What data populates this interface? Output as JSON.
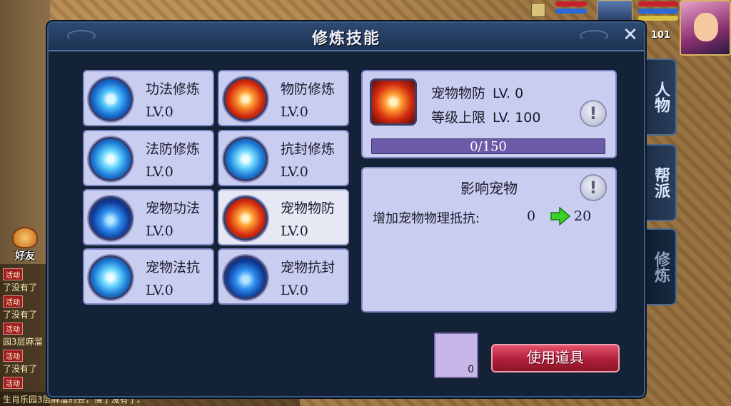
{
  "dialog": {
    "title": "修炼技能"
  },
  "skills": [
    {
      "name": "功法修炼",
      "level": "LV.0",
      "icon": "kungfu-cultivation-icon"
    },
    {
      "name": "物防修炼",
      "level": "LV.0",
      "icon": "physical-defense-icon"
    },
    {
      "name": "法防修炼",
      "level": "LV.0",
      "icon": "magic-defense-icon"
    },
    {
      "name": "抗封修炼",
      "level": "LV.0",
      "icon": "seal-resist-icon"
    },
    {
      "name": "宠物功法",
      "level": "LV.0",
      "icon": "pet-kungfu-icon"
    },
    {
      "name": "宠物物防",
      "level": "LV.0",
      "icon": "pet-physical-defense-icon",
      "selected": true
    },
    {
      "name": "宠物法抗",
      "level": "LV.0",
      "icon": "pet-magic-resist-icon"
    },
    {
      "name": "宠物抗封",
      "level": "LV.0",
      "icon": "pet-seal-resist-icon"
    }
  ],
  "detail": {
    "name": "宠物物防",
    "level": "LV. 0",
    "cap_label": "等级上限",
    "cap_value": "LV. 100",
    "progress_text": "0/150",
    "progress_current": 0,
    "progress_max": 150,
    "info_glyph": "!"
  },
  "affect": {
    "title": "影响宠物",
    "label": "增加宠物物理抵抗:",
    "from": "0",
    "to": "20",
    "info_glyph": "!"
  },
  "item": {
    "count": "0"
  },
  "use_button": "使用道具",
  "side_tabs": [
    {
      "label": "人物"
    },
    {
      "label": "帮派"
    },
    {
      "label": "修炼",
      "active": true
    }
  ],
  "hud": {
    "level": "101"
  },
  "friends": {
    "label": "好友"
  },
  "chat": {
    "tag": "活动",
    "lines": [
      "了没有了",
      "了没有了",
      "园3层麻溜",
      "了没有了"
    ],
    "bottom": "生肖乐园3层麻溜的去，慢了没有了。"
  },
  "colors": {
    "panel": "#c9cdf0",
    "dialog_bg": "#142238",
    "use_button": "#b0203a",
    "progress": "#6a5aa8"
  }
}
